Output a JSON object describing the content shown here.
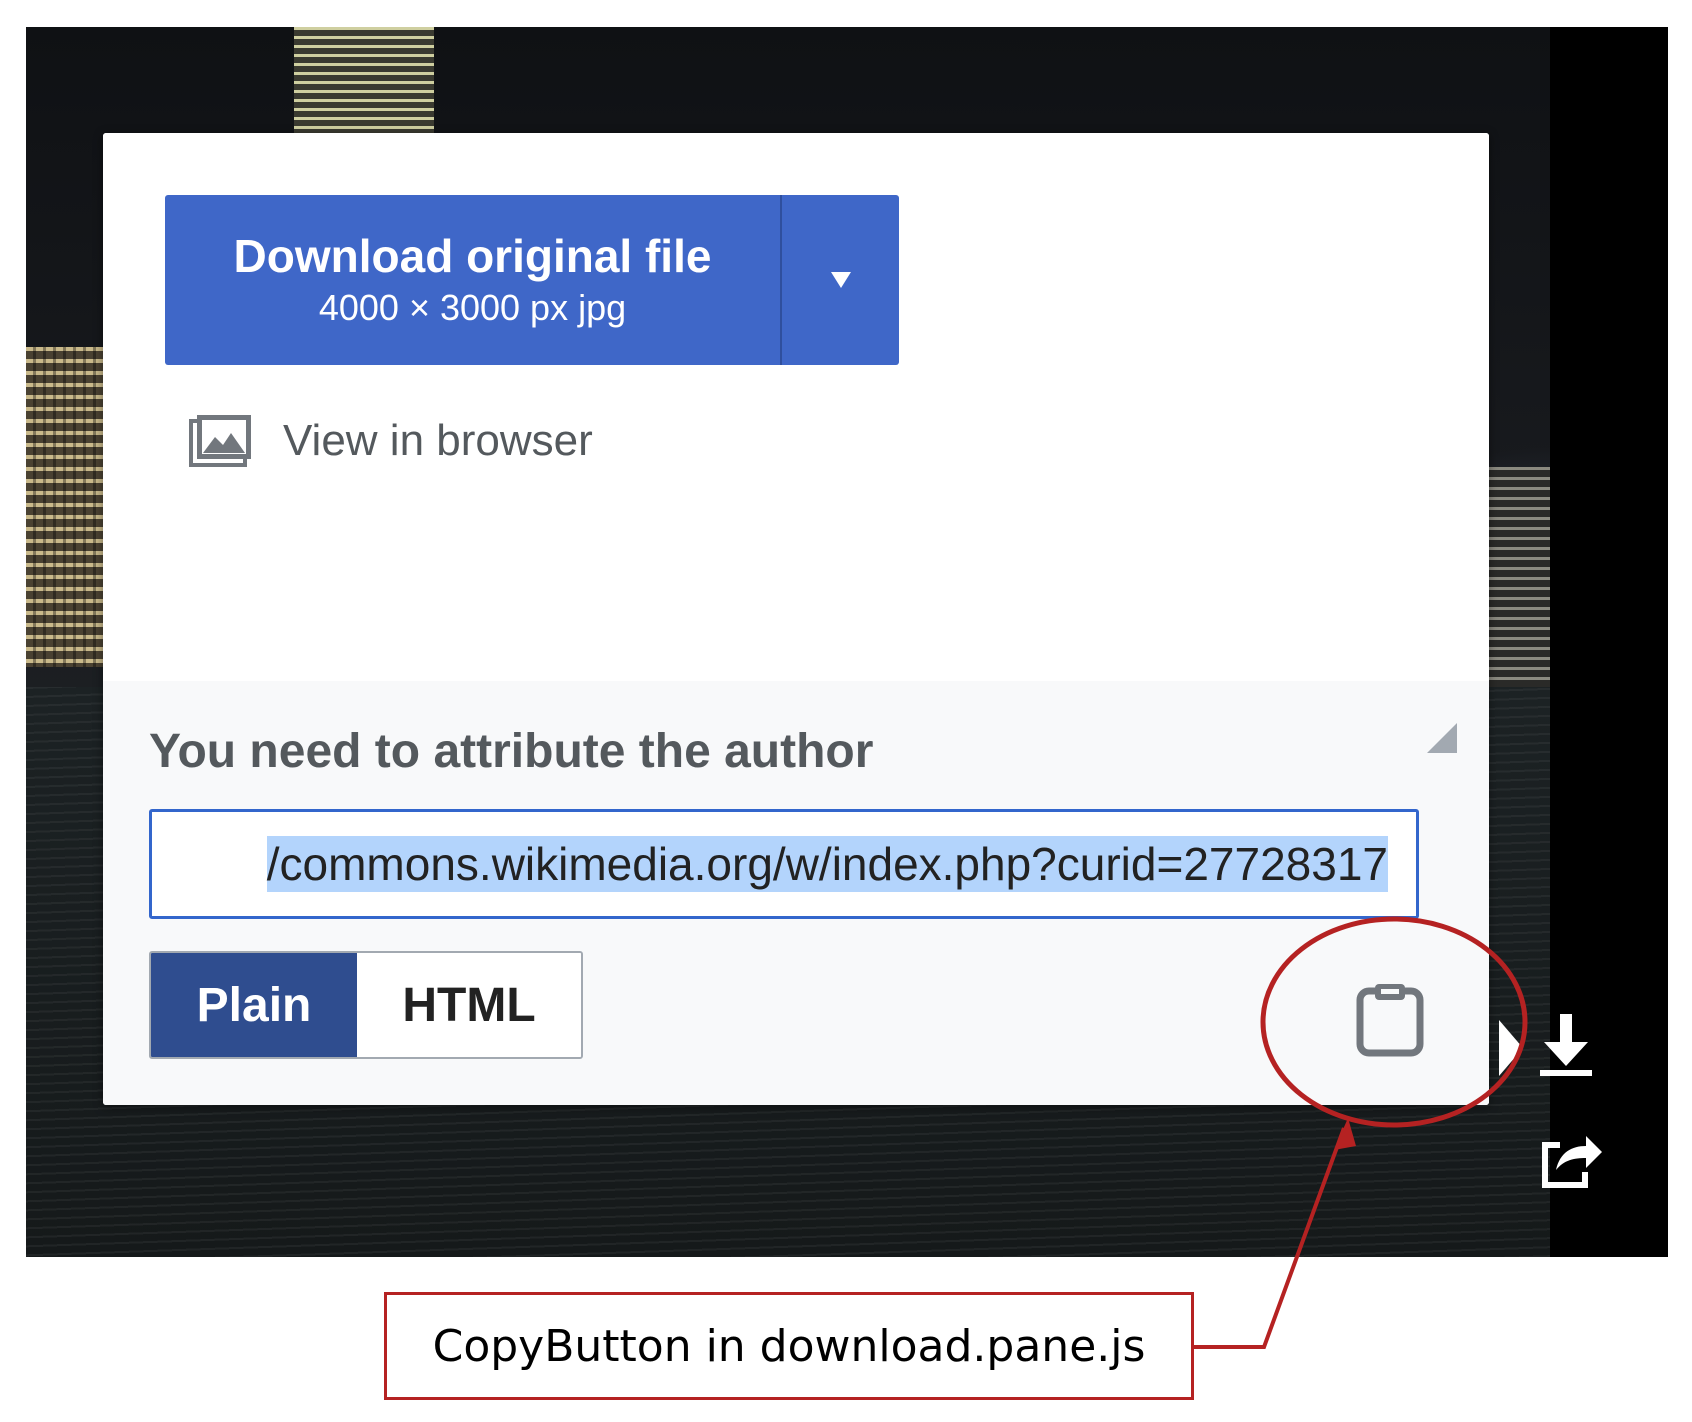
{
  "dialog": {
    "download_button": {
      "title": "Download original file",
      "subtitle": "4000 × 3000 px jpg"
    },
    "view_in_browser": "View in browser",
    "attribution": {
      "heading": "You need to attribute the author",
      "value": "/commons.wikimedia.org/w/index.php?curid=27728317",
      "formats": [
        "Plain",
        "HTML"
      ],
      "selected_format": "Plain"
    }
  },
  "side_toolbar": {
    "icons": [
      "download-icon",
      "share-icon"
    ]
  },
  "annotation": {
    "label": "CopyButton in download.pane.js",
    "color": "#b52222"
  },
  "colors": {
    "primary_button": "#3f67c8",
    "selected_toggle": "#2f4d8f",
    "input_border": "#3366cc",
    "selection_highlight": "#b3d4fc"
  }
}
